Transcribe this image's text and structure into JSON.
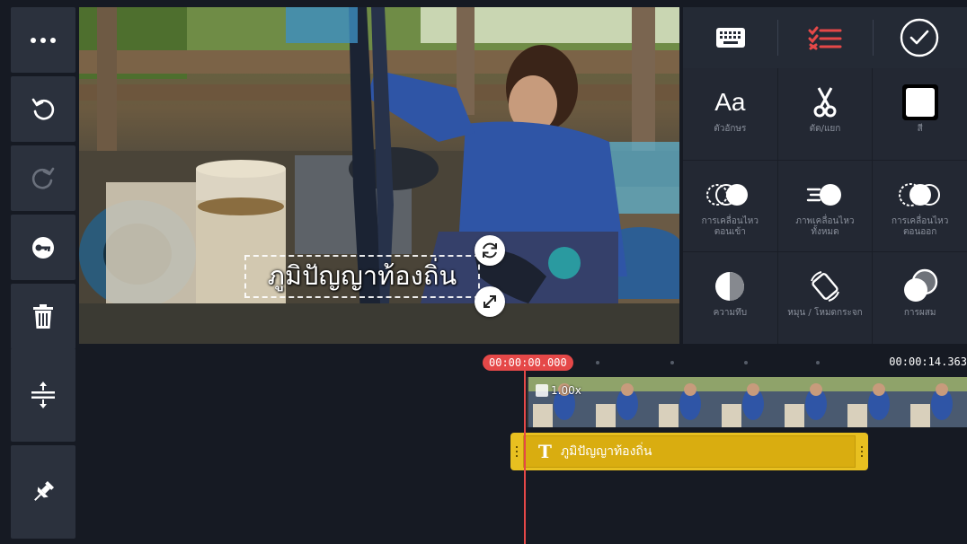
{
  "rail": {
    "items": [
      {
        "icon": "more-icon"
      },
      {
        "icon": "undo-icon"
      },
      {
        "icon": "redo-icon"
      },
      {
        "icon": "keyframe-icon"
      },
      {
        "icon": "delete-icon"
      }
    ],
    "bottom": [
      {
        "icon": "track-height-icon"
      },
      {
        "icon": "pin-icon"
      }
    ]
  },
  "preview": {
    "overlay_text": "ภูมิปัญญาท้องถิ่น"
  },
  "panel": {
    "tabs": [
      {
        "icon": "keyboard-icon"
      },
      {
        "icon": "options-list-icon",
        "active": true
      },
      {
        "icon": "checkmark-icon"
      }
    ],
    "options": [
      {
        "label": "ตัวอักษร",
        "icon": "font-icon",
        "glyph": "Aa"
      },
      {
        "label": "ตัด/แยก",
        "icon": "scissors-icon"
      },
      {
        "label": "สี",
        "icon": "color-icon"
      },
      {
        "label": "การเคลื่อนไหว\nตอนเข้า",
        "icon": "in-animation-icon"
      },
      {
        "label": "ภาพเคลื่อนไหว\nทั้งหมด",
        "icon": "overall-animation-icon"
      },
      {
        "label": "การเคลื่อนไหว\nตอนออก",
        "icon": "out-animation-icon"
      },
      {
        "label": "ความทึบ",
        "icon": "opacity-icon"
      },
      {
        "label": "หมุน / โหมดกระจก",
        "icon": "rotate-mirror-icon"
      },
      {
        "label": "การผสม",
        "icon": "blending-icon"
      }
    ]
  },
  "timeline": {
    "current_time": "00:00:00.000",
    "total_time": "00:00:14.363",
    "speed": "1.00x",
    "text_clip_label": "ภูมิปัญญาท้องถิ่น"
  },
  "colors": {
    "accent_red": "#e54848",
    "clip_yellow": "#e8c020",
    "panel_bg": "#232833"
  }
}
